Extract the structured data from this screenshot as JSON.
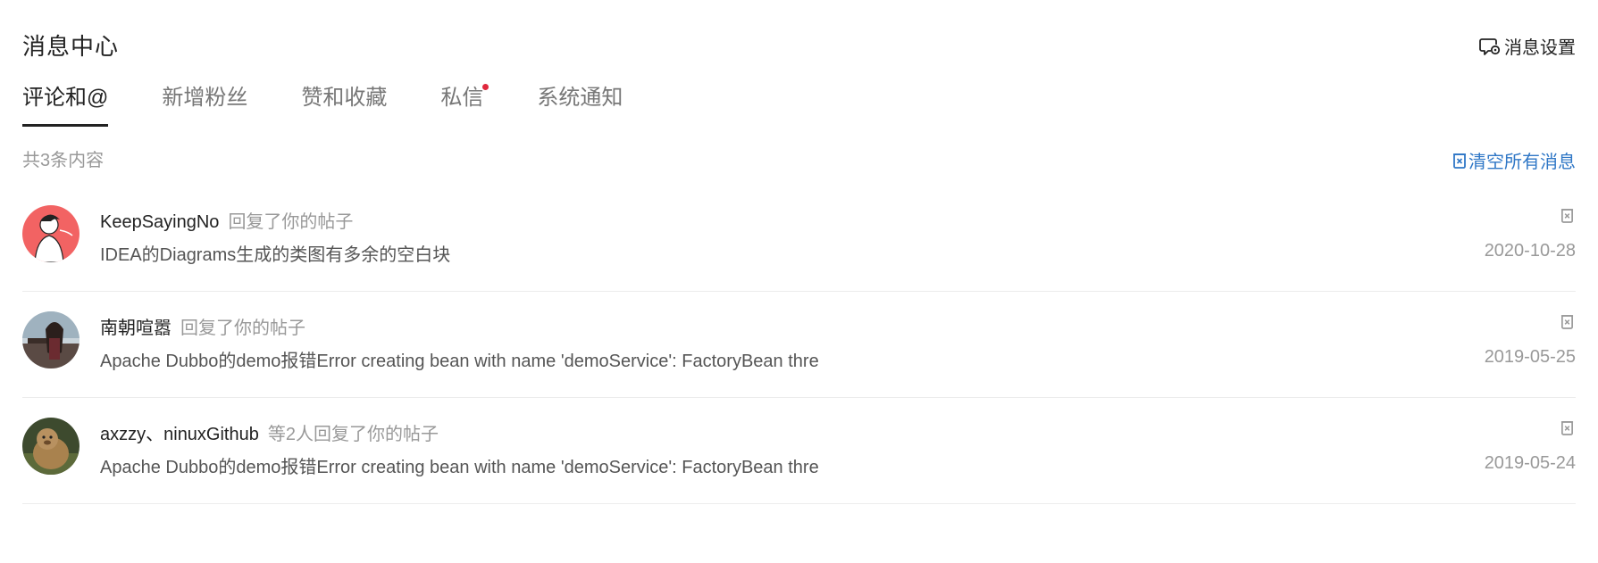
{
  "header": {
    "title": "消息中心",
    "settings_label": "消息设置",
    "settings_icon": "message-settings-icon"
  },
  "tabs": [
    {
      "label": "评论和@",
      "active": true
    },
    {
      "label": "新增粉丝"
    },
    {
      "label": "赞和收藏"
    },
    {
      "label": "私信",
      "has_unread_dot": true
    },
    {
      "label": "系统通知"
    }
  ],
  "summary": "共3条内容",
  "clear_all": {
    "label": "清空所有消息",
    "icon": "trash-icon"
  },
  "colors": {
    "link_blue": "#2f77c6",
    "unread_dot": "#e0283d",
    "avatar_1_bg": "#f26363"
  },
  "messages": [
    {
      "user": "KeepSayingNo",
      "action": "回复了你的帖子",
      "text": "IDEA的Diagrams生成的类图有多余的空白块",
      "date": "2020-10-28"
    },
    {
      "user": "南朝喧嚣",
      "action": "回复了你的帖子",
      "text": "Apache Dubbo的demo报错Error creating bean with name 'demoService': FactoryBean thre",
      "date": "2019-05-25"
    },
    {
      "user": "axzzy、ninuxGithub",
      "action": "等2人回复了你的帖子",
      "text": "Apache Dubbo的demo报错Error creating bean with name 'demoService': FactoryBean thre",
      "date": "2019-05-24"
    }
  ]
}
